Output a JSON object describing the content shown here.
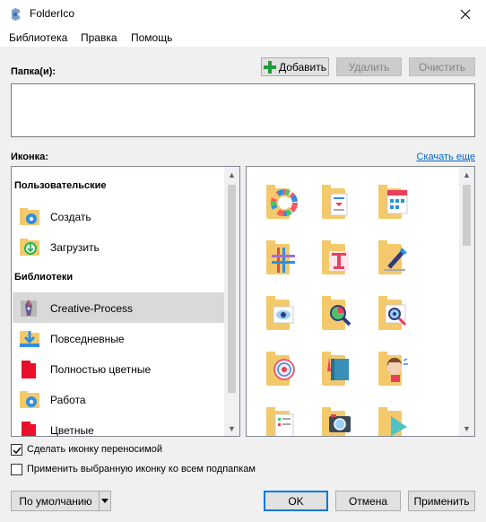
{
  "window": {
    "title": "FolderIco",
    "close_icon": "close-icon"
  },
  "menu": {
    "items": [
      "Библиотека",
      "Правка",
      "Помощь"
    ]
  },
  "folders": {
    "label": "Папка(и):",
    "add_label": "Добавить",
    "remove_label": "Удалить",
    "clear_label": "Очистить",
    "add_icon": "plus-icon"
  },
  "icons": {
    "label": "Иконка:",
    "download_more": "Скачать еще"
  },
  "list": {
    "sections": [
      "Пользовательские",
      "Библиотеки"
    ],
    "custom_items": [
      {
        "label": "Создать",
        "icon": "gear-folder-icon"
      },
      {
        "label": "Загрузить",
        "icon": "download-folder-icon"
      }
    ],
    "library_items": [
      {
        "label": "Creative-Process",
        "icon": "creative-process-icon",
        "selected": true
      },
      {
        "label": "Повседневные",
        "icon": "everyday-folder-icon"
      },
      {
        "label": "Полностью цветные",
        "icon": "red-folder-icon"
      },
      {
        "label": "Работа",
        "icon": "work-gear-folder-icon"
      },
      {
        "label": "Цветные",
        "icon": "red-folder-icon"
      }
    ]
  },
  "grid": {
    "icons": [
      "color-wheel-folder-icon",
      "document-folder-icon",
      "calendar-folder-icon",
      "grid-design-folder-icon",
      "typography-folder-icon",
      "pen-tool-folder-icon",
      "eye-folder-icon",
      "color-magnifier-folder-icon",
      "eye-magnifier-folder-icon",
      "target-folder-icon",
      "sketchbook-folder-icon",
      "brainstorm-folder-icon",
      "checklist-folder-icon",
      "camera-folder-icon",
      "shapes-folder-icon"
    ]
  },
  "options": {
    "portable_label": "Сделать иконку переносимой",
    "portable_checked": true,
    "apply_sub_label": "Применить выбранную иконку ко всем подпапкам",
    "apply_sub_checked": false
  },
  "buttons": {
    "default_label": "По умолчанию",
    "ok_label": "OK",
    "cancel_label": "Отмена",
    "apply_label": "Применить"
  },
  "colors": {
    "folder": "#f3c96b",
    "accent": "#0078d7",
    "link": "#0066cc",
    "selected_row": "#d9d9d9"
  }
}
